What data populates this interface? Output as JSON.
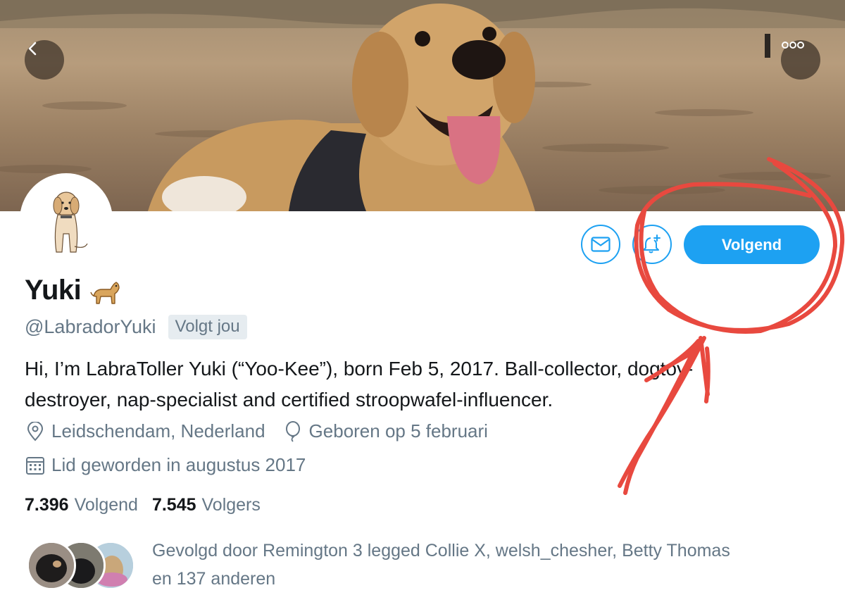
{
  "header": {
    "back_icon": "chevron-left-icon",
    "more_icon": "more-horizontal-icon",
    "banner_description": "dog-on-beach-photo"
  },
  "profile": {
    "name": "Yuki",
    "name_emoji": "dog-emoji",
    "handle": "@LabradorYuki",
    "follows_you_badge": "Volgt jou",
    "bio_line1": "Hi, I’m LabraToller Yuki (“Yoo-Kee”), born Feb 5, 2017. Ball-collector, dogtoy-",
    "bio_line2": "destroyer, nap-specialist and certified stroopwafel-influencer.",
    "location": "Leidschendam, Nederland",
    "birthday": "Geboren op 5 februari",
    "joined": "Lid geworden in augustus 2017",
    "following_count": "7.396",
    "following_label": "Volgend",
    "followers_count": "7.545",
    "followers_label": "Volgers",
    "followed_by_line1": "Gevolgd door Remington 3 legged Collie X, welsh_chesher, Betty Thomas",
    "followed_by_line2": "en 137 anderen"
  },
  "actions": {
    "message_icon": "envelope-icon",
    "notify_icon": "bell-plus-icon",
    "follow_label": "Volgend"
  },
  "colors": {
    "accent": "#1da1f2",
    "secondary_text": "#657786",
    "annotation": "#e8493f"
  }
}
